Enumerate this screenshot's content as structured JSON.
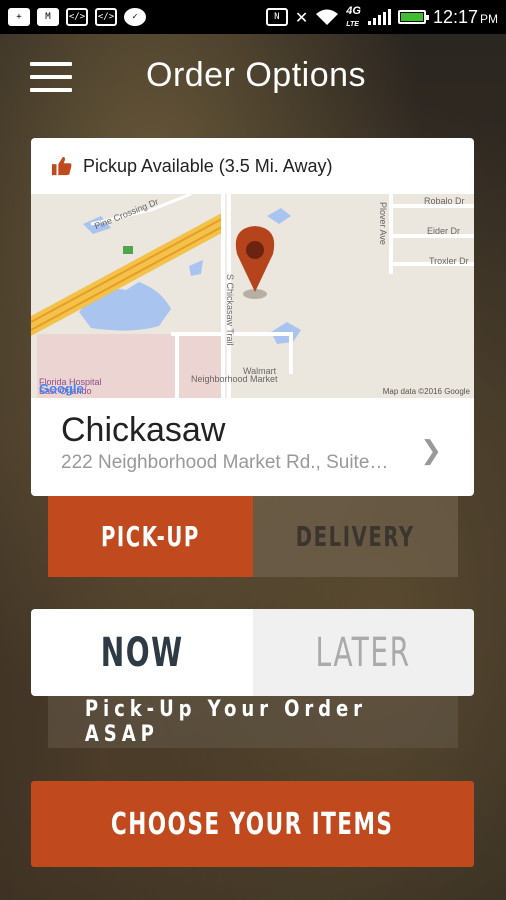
{
  "status_bar": {
    "icons": [
      "add-icon",
      "mail-icon",
      "code-icon",
      "code-icon",
      "chat-icon"
    ],
    "right_icons": [
      "nfc-icon",
      "mute-icon",
      "wifi-icon",
      "lte-icon",
      "signal-icon",
      "battery-icon"
    ],
    "network": "4G",
    "network_sub": "LTE",
    "time": "12:17",
    "ampm": "PM"
  },
  "header": {
    "title": "Order Options",
    "menu_icon": "hamburger-icon"
  },
  "location_card": {
    "availability": "Pickup Available (3.5 Mi. Away)",
    "thumb_icon": "thumbs-up-icon",
    "map": {
      "labels": {
        "robalo": "Robalo Dr",
        "plover": "Plover Ave",
        "eider": "Eider Dr",
        "troxler": "Troxler Dr",
        "pine": "Pine Crossing Dr",
        "chickasaw": "S Chickasaw Trail",
        "hospital": "Florida Hospital East Orlando",
        "walmart": "Walmart",
        "neighborhood": "Neighborhood Market"
      },
      "attribution": "Map data ©2016 Google",
      "logo": "Google",
      "pin_icon": "map-pin-icon"
    },
    "store_name": "Chickasaw",
    "store_address": "222 Neighborhood Market Rd., Suite…",
    "chevron_icon": "chevron-right-icon"
  },
  "fulfillment": {
    "pickup": "PICK-UP",
    "delivery": "DELIVERY",
    "selected": "pickup"
  },
  "timing": {
    "now": "NOW",
    "later": "LATER",
    "selected": "now"
  },
  "timing_message": "Pick-Up Your Order ASAP",
  "cta": {
    "label": "CHOOSE YOUR ITEMS"
  },
  "colors": {
    "accent": "#c1491e",
    "pin": "#b5441d",
    "text_dark": "#2e3a44"
  }
}
